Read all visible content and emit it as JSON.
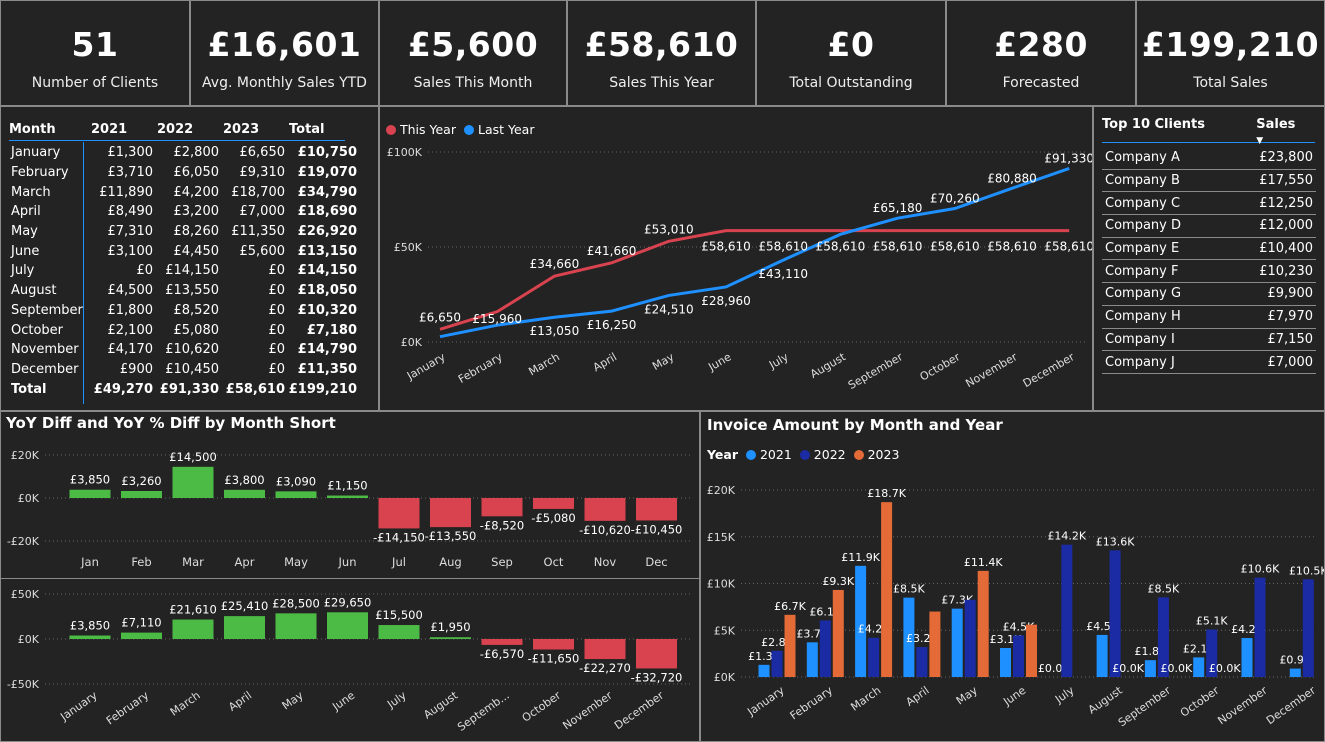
{
  "kpis": [
    {
      "value": "51",
      "label": "Number of Clients"
    },
    {
      "value": "£16,601",
      "label": "Avg. Monthly Sales YTD"
    },
    {
      "value": "£5,600",
      "label": "Sales This Month"
    },
    {
      "value": "£58,610",
      "label": "Sales This Year"
    },
    {
      "value": "£0",
      "label": "Total Outstanding"
    },
    {
      "value": "£280",
      "label": "Forecasted"
    },
    {
      "value": "£199,210",
      "label": "Total Sales"
    }
  ],
  "monthly_table": {
    "headers": [
      "Month",
      "2021",
      "2022",
      "2023",
      "Total"
    ],
    "rows": [
      [
        "January",
        "£1,300",
        "£2,800",
        "£6,650",
        "£10,750"
      ],
      [
        "February",
        "£3,710",
        "£6,050",
        "£9,310",
        "£19,070"
      ],
      [
        "March",
        "£11,890",
        "£4,200",
        "£18,700",
        "£34,790"
      ],
      [
        "April",
        "£8,490",
        "£3,200",
        "£7,000",
        "£18,690"
      ],
      [
        "May",
        "£7,310",
        "£8,260",
        "£11,350",
        "£26,920"
      ],
      [
        "June",
        "£3,100",
        "£4,450",
        "£5,600",
        "£13,150"
      ],
      [
        "July",
        "£0",
        "£14,150",
        "£0",
        "£14,150"
      ],
      [
        "August",
        "£4,500",
        "£13,550",
        "£0",
        "£18,050"
      ],
      [
        "September",
        "£1,800",
        "£8,520",
        "£0",
        "£10,320"
      ],
      [
        "October",
        "£2,100",
        "£5,080",
        "£0",
        "£7,180"
      ],
      [
        "November",
        "£4,170",
        "£10,620",
        "£0",
        "£14,790"
      ],
      [
        "December",
        "£900",
        "£10,450",
        "£0",
        "£11,350"
      ]
    ],
    "total": [
      "Total",
      "£49,270",
      "£91,330",
      "£58,610",
      "£199,210"
    ]
  },
  "top_clients": {
    "headers": [
      "Top 10 Clients",
      "Sales"
    ],
    "rows": [
      [
        "Company A",
        "£23,800"
      ],
      [
        "Company B",
        "£17,550"
      ],
      [
        "Company C",
        "£12,250"
      ],
      [
        "Company D",
        "£12,000"
      ],
      [
        "Company E",
        "£10,400"
      ],
      [
        "Company F",
        "£10,230"
      ],
      [
        "Company G",
        "£9,900"
      ],
      [
        "Company H",
        "£7,970"
      ],
      [
        "Company I",
        "£7,150"
      ],
      [
        "Company J",
        "£7,000"
      ]
    ]
  },
  "titles": {
    "yoy": "YoY Diff and YoY % Diff by Month Short",
    "invoice": "Invoice Amount by Month and Year",
    "invoice_legend_title": "Year"
  },
  "colors": {
    "this_year": "#d9434f",
    "last_year": "#1e90ff",
    "pos": "#4cbb45",
    "neg": "#d9434f",
    "y2021": "#1e90ff",
    "y2022": "#1a2ba3",
    "y2023": "#e46b38"
  },
  "chart_data": [
    {
      "type": "line",
      "x": [
        "January",
        "February",
        "March",
        "April",
        "May",
        "June",
        "July",
        "August",
        "September",
        "October",
        "November",
        "December"
      ],
      "series": [
        {
          "name": "This Year",
          "values": [
            6650,
            15960,
            34660,
            41660,
            53010,
            58610,
            58610,
            58610,
            58610,
            58610,
            58610,
            58610
          ],
          "labels": [
            "£6,650",
            "",
            "£34,660",
            "£41,660",
            "£53,010",
            "£58,610",
            "£58,610",
            "£58,610",
            "£58,610",
            "£58,610",
            "£58,610",
            "£58,610"
          ]
        },
        {
          "name": "Last Year",
          "values": [
            2800,
            8850,
            13050,
            16250,
            24510,
            28960,
            43110,
            56660,
            65180,
            70260,
            80880,
            91330
          ],
          "labels": [
            "",
            "£15,960",
            "£13,050",
            "£16,250",
            "£24,510",
            "£28,960",
            "£43,110",
            "",
            "£65,180",
            "£70,260",
            "£80,880",
            "£91,330"
          ]
        }
      ],
      "yticks": [
        "£0K",
        "£50K",
        "£100K"
      ],
      "ylim": [
        0,
        100000
      ]
    },
    {
      "type": "bar",
      "categories": [
        "Jan",
        "Feb",
        "Mar",
        "Apr",
        "May",
        "Jun",
        "Jul",
        "Aug",
        "Sep",
        "Oct",
        "Nov",
        "Dec"
      ],
      "values": [
        3850,
        3260,
        14500,
        3800,
        3090,
        1150,
        -14150,
        -13550,
        -8520,
        -5080,
        -10620,
        -10450
      ],
      "labels": [
        "£3,850",
        "£3,260",
        "£14,500",
        "£3,800",
        "£3,090",
        "£1,150",
        "-£14,150",
        "-£13,550",
        "-£8,520",
        "-£5,080",
        "-£10,620",
        "-£10,450"
      ],
      "yticks": [
        "£20K",
        "£0K",
        "-£20K"
      ],
      "ylim": [
        -20000,
        20000
      ]
    },
    {
      "type": "bar",
      "categories": [
        "January",
        "February",
        "March",
        "April",
        "May",
        "June",
        "July",
        "August",
        "Septemb...",
        "October",
        "November",
        "December"
      ],
      "values": [
        3850,
        7110,
        21610,
        25410,
        28500,
        29650,
        15500,
        1950,
        -6570,
        -11650,
        -22270,
        -32720
      ],
      "labels": [
        "£3,850",
        "£7,110",
        "£21,610",
        "£25,410",
        "£28,500",
        "£29,650",
        "£15,500",
        "£1,950",
        "-£6,570",
        "-£11,650",
        "-£22,270",
        "-£32,720"
      ],
      "yticks": [
        "£50K",
        "£0K",
        "-£50K"
      ],
      "ylim": [
        -50000,
        50000
      ]
    },
    {
      "type": "bar",
      "categories": [
        "January",
        "February",
        "March",
        "April",
        "May",
        "June",
        "July",
        "August",
        "September",
        "October",
        "November",
        "December"
      ],
      "series": [
        {
          "name": "2021",
          "values": [
            1300,
            3710,
            11890,
            8490,
            7310,
            3100,
            0,
            4500,
            1800,
            2100,
            4170,
            900
          ],
          "labels": [
            "£1.3K",
            "£3.7K",
            "£11.9K",
            "£8.5K",
            "£7.3K",
            "£3.1K",
            "£0.0K",
            "£4.5K",
            "£1.8K",
            "£2.1K",
            "£4.2K",
            "£0.9K"
          ]
        },
        {
          "name": "2022",
          "values": [
            2800,
            6050,
            4200,
            3200,
            8260,
            4450,
            14150,
            13550,
            8520,
            5080,
            10620,
            10450
          ],
          "labels": [
            "£2.8K",
            "£6.1K",
            "£4.2K",
            "£3.2K",
            "",
            "£4.5K",
            "£14.2K",
            "£13.6K",
            "£8.5K",
            "£5.1K",
            "£10.6K",
            "£10.5K"
          ]
        },
        {
          "name": "2023",
          "values": [
            6650,
            9310,
            18700,
            7000,
            11350,
            5600,
            0,
            0,
            0,
            0,
            0,
            0
          ],
          "labels": [
            "£6.7K",
            "£9.3K",
            "£18.7K",
            "",
            "£11.4K",
            "",
            "",
            "£0.0K",
            "£0.0K",
            "£0.0K",
            "",
            ""
          ]
        }
      ],
      "yticks": [
        "£0K",
        "£5K",
        "£10K",
        "£15K",
        "£20K"
      ],
      "ylim": [
        0,
        20000
      ]
    }
  ]
}
